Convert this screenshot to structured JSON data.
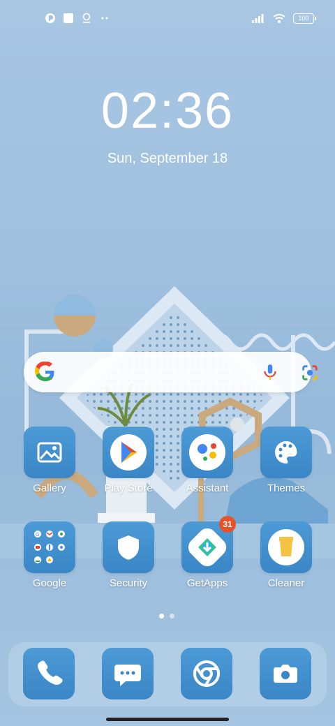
{
  "status_bar": {
    "battery": "100",
    "left_icons": [
      "app-icon",
      "square-icon",
      "location-icon",
      "more-dots-icon"
    ],
    "right_icons": [
      "signal-icon",
      "wifi-icon",
      "battery-icon"
    ]
  },
  "lock": {
    "time": "02:36",
    "date": "Sun, September 18"
  },
  "search_bar": {
    "icons": [
      "google-g-icon",
      "mic-icon",
      "lens-icon"
    ]
  },
  "apps": [
    {
      "label": "Gallery",
      "icon": "gallery-icon"
    },
    {
      "label": "Play Store",
      "icon": "play-store-icon"
    },
    {
      "label": "Assistant",
      "icon": "assistant-icon"
    },
    {
      "label": "Themes",
      "icon": "palette-icon"
    },
    {
      "label": "Google",
      "icon": "google-folder-icon"
    },
    {
      "label": "Security",
      "icon": "shield-icon"
    },
    {
      "label": "GetApps",
      "icon": "getapps-icon",
      "badge": "31"
    },
    {
      "label": "Cleaner",
      "icon": "cleaner-icon"
    }
  ],
  "page_indicator": {
    "pages": 2,
    "current": 1
  },
  "dock": [
    {
      "icon": "phone-icon"
    },
    {
      "icon": "messages-icon"
    },
    {
      "icon": "chrome-icon"
    },
    {
      "icon": "camera-icon"
    }
  ],
  "colors": {
    "icon_bg": "#4095d1",
    "badge": "#e4532a",
    "wallpaper": "#a3c3e0"
  }
}
